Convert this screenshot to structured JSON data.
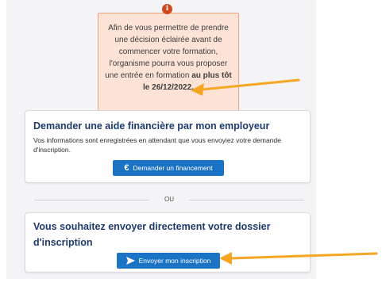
{
  "notice": {
    "icon": "info-icon",
    "lines": [
      "Afin de vous permettre de prendre",
      "une décision éclairée avant de",
      "commencer votre formation,",
      "l'organisme pourra vous proposer"
    ],
    "line5_prefix": "une entrée en formation ",
    "line5_bold": "au plus tôt",
    "date_bold": "le 26/12/2022."
  },
  "employer_card": {
    "title": "Demander une aide financière par mon employeur",
    "description": "Vos informations sont enregistrées en attendant que vous envoyiez votre demande d'inscription.",
    "button_icon": "euro-icon",
    "button_label": "Demander un financement"
  },
  "separator_label": "OU",
  "direct_card": {
    "title": "Vous souhaitez envoyer directement votre dossier d'inscription",
    "button_icon": "send-icon",
    "button_label": "Envoyer mon inscription"
  },
  "colors": {
    "accent": "#1b73c5",
    "title": "#1d3a6e",
    "notice_bg": "#fce3d6",
    "notice_border": "#f0a27e",
    "info_icon": "#d0481d",
    "arrow": "#f5a623"
  }
}
